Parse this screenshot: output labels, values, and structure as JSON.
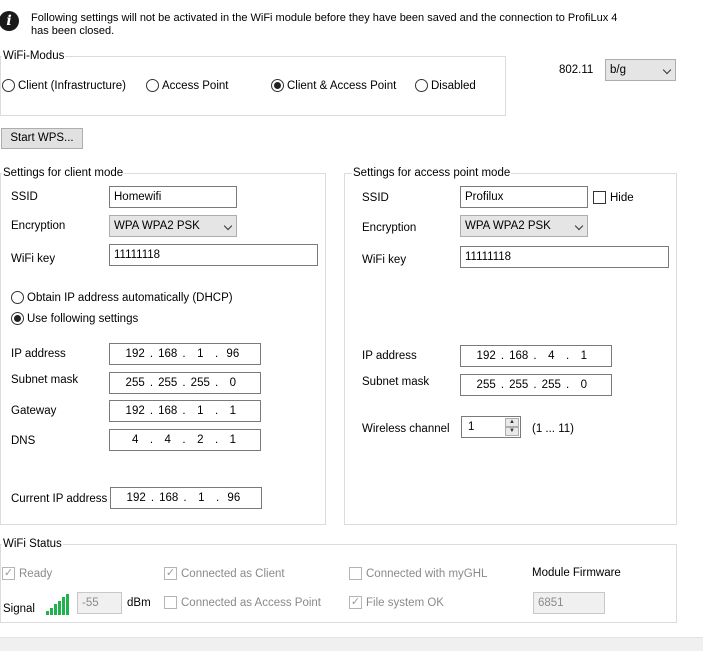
{
  "notice": "Following settings will not be activated in the WiFi module before they have been saved and the connection to ProfiLux 4 has been closed.",
  "wifi_mode": {
    "title": "WiFi-Modus",
    "options": [
      {
        "label": "Client (Infrastructure)",
        "selected": false
      },
      {
        "label": "Access Point",
        "selected": false
      },
      {
        "label": "Client & Access Point",
        "selected": true
      },
      {
        "label": "Disabled",
        "selected": false
      }
    ]
  },
  "standard": {
    "label": "802.11",
    "value": "b/g"
  },
  "wps_button": "Start WPS...",
  "client": {
    "title": "Settings for client mode",
    "ssid_label": "SSID",
    "ssid": "Homewifi",
    "encryption_label": "Encryption",
    "encryption": "WPA WPA2 PSK",
    "key_label": "WiFi key",
    "key": "11111118",
    "dhcp_label": "Obtain IP address automatically (DHCP)",
    "manual_label": "Use following settings",
    "ip_label": "IP address",
    "ip": [
      "192",
      "168",
      "1",
      "96"
    ],
    "subnet_label": "Subnet mask",
    "subnet": [
      "255",
      "255",
      "255",
      "0"
    ],
    "gateway_label": "Gateway",
    "gateway": [
      "192",
      "168",
      "1",
      "1"
    ],
    "dns_label": "DNS",
    "dns": [
      "4",
      "4",
      "2",
      "1"
    ],
    "current_ip_label": "Current IP address",
    "current_ip": [
      "192",
      "168",
      "1",
      "96"
    ]
  },
  "ap": {
    "title": "Settings for access point mode",
    "ssid_label": "SSID",
    "ssid": "Profilux",
    "hide_label": "Hide",
    "encryption_label": "Encryption",
    "encryption": "WPA WPA2 PSK",
    "key_label": "WiFi key",
    "key": "11111118",
    "ip_label": "IP address",
    "ip": [
      "192",
      "168",
      "4",
      "1"
    ],
    "subnet_label": "Subnet mask",
    "subnet": [
      "255",
      "255",
      "255",
      "0"
    ],
    "channel_label": "Wireless channel",
    "channel": "1",
    "channel_range": "(1 ... 11)"
  },
  "status": {
    "title": "WiFi Status",
    "ready": "Ready",
    "connected_client": "Connected as Client",
    "connected_mygh": "Connected with myGHL",
    "firmware_label": "Module Firmware",
    "firmware": "6851",
    "signal_label": "Signal",
    "signal_value": "-55",
    "signal_unit": "dBm",
    "connected_ap": "Connected as Access Point",
    "filesystem": "File system OK",
    "signal_bars": 6,
    "signal_color": "#22b14c"
  }
}
